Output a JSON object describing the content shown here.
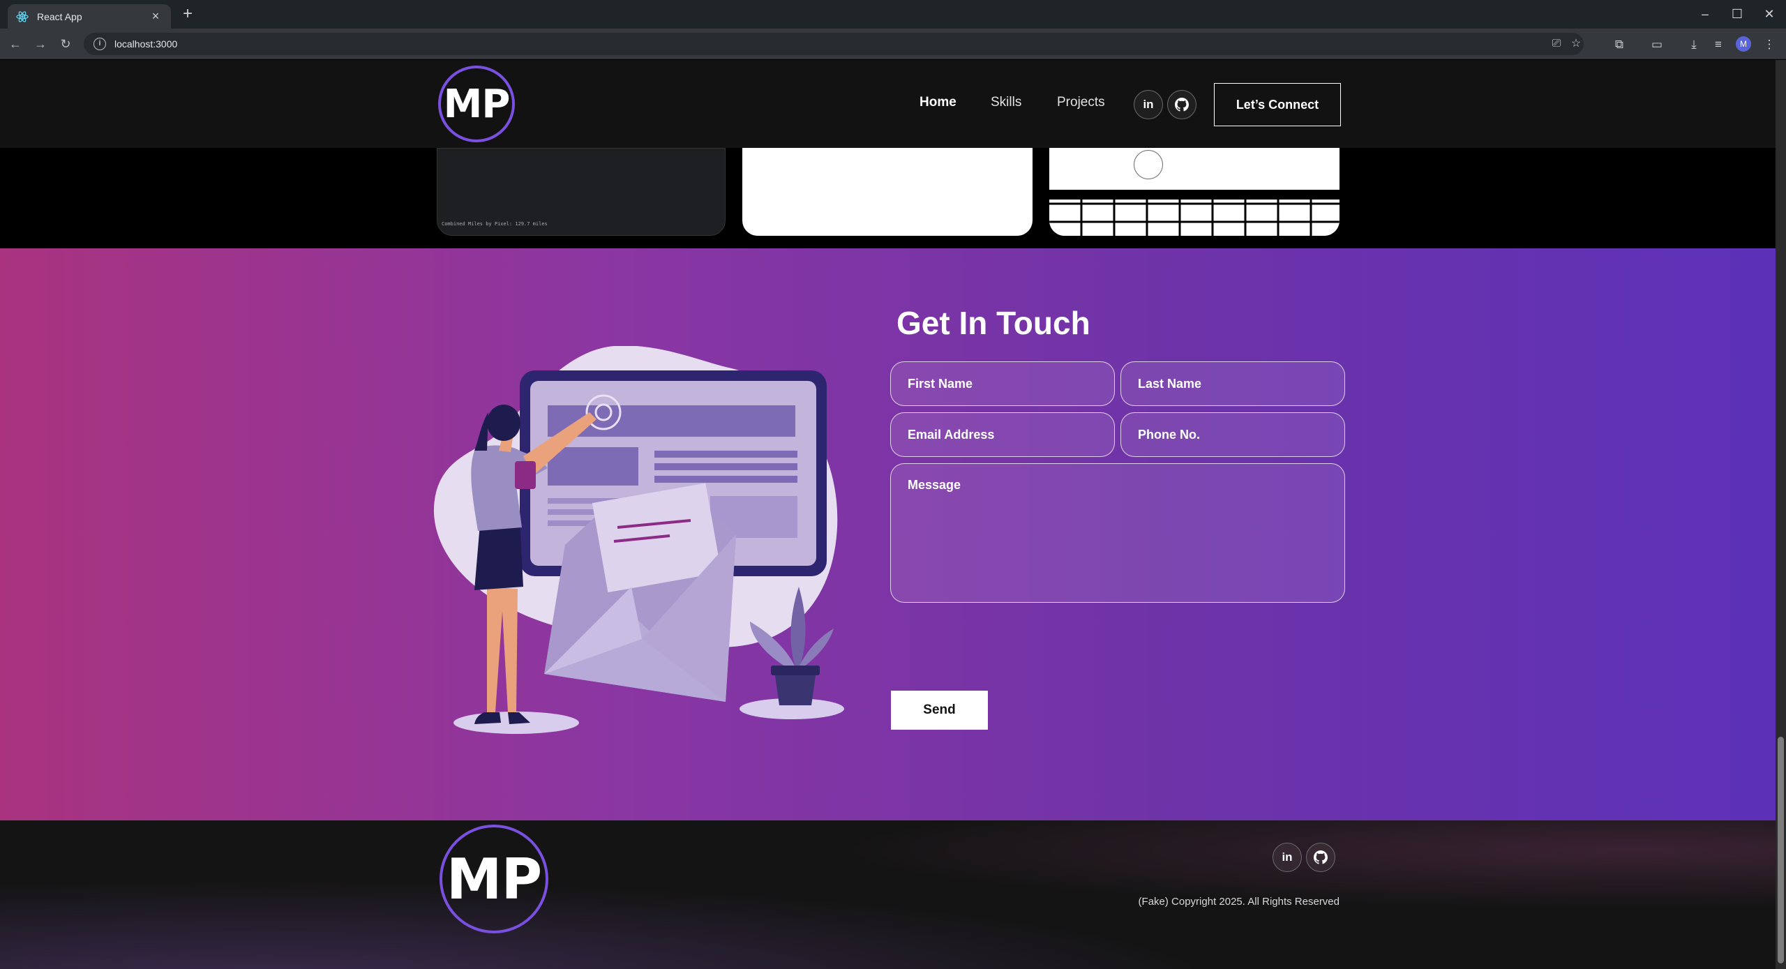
{
  "browser": {
    "tab_title": "React App",
    "url": "localhost:3000",
    "profile_initial": "M"
  },
  "navbar": {
    "logo": "MP",
    "links": [
      "Home",
      "Skills",
      "Projects"
    ],
    "connect_label": "Let’s Connect"
  },
  "projects_strip": {
    "card_caption": "Combined Miles by Pixel: 129.7 miles"
  },
  "contact": {
    "title": "Get In Touch",
    "placeholders": {
      "first_name": "First Name",
      "last_name": "Last Name",
      "email": "Email Address",
      "phone": "Phone No.",
      "message": "Message"
    },
    "send_label": "Send"
  },
  "footer": {
    "logo": "MP",
    "copyright": "(Fake) Copyright 2025. All Rights Reserved"
  },
  "colors": {
    "accent": "#7a50e0",
    "gradient_start": "#a9337f",
    "gradient_end": "#5c31b8"
  }
}
